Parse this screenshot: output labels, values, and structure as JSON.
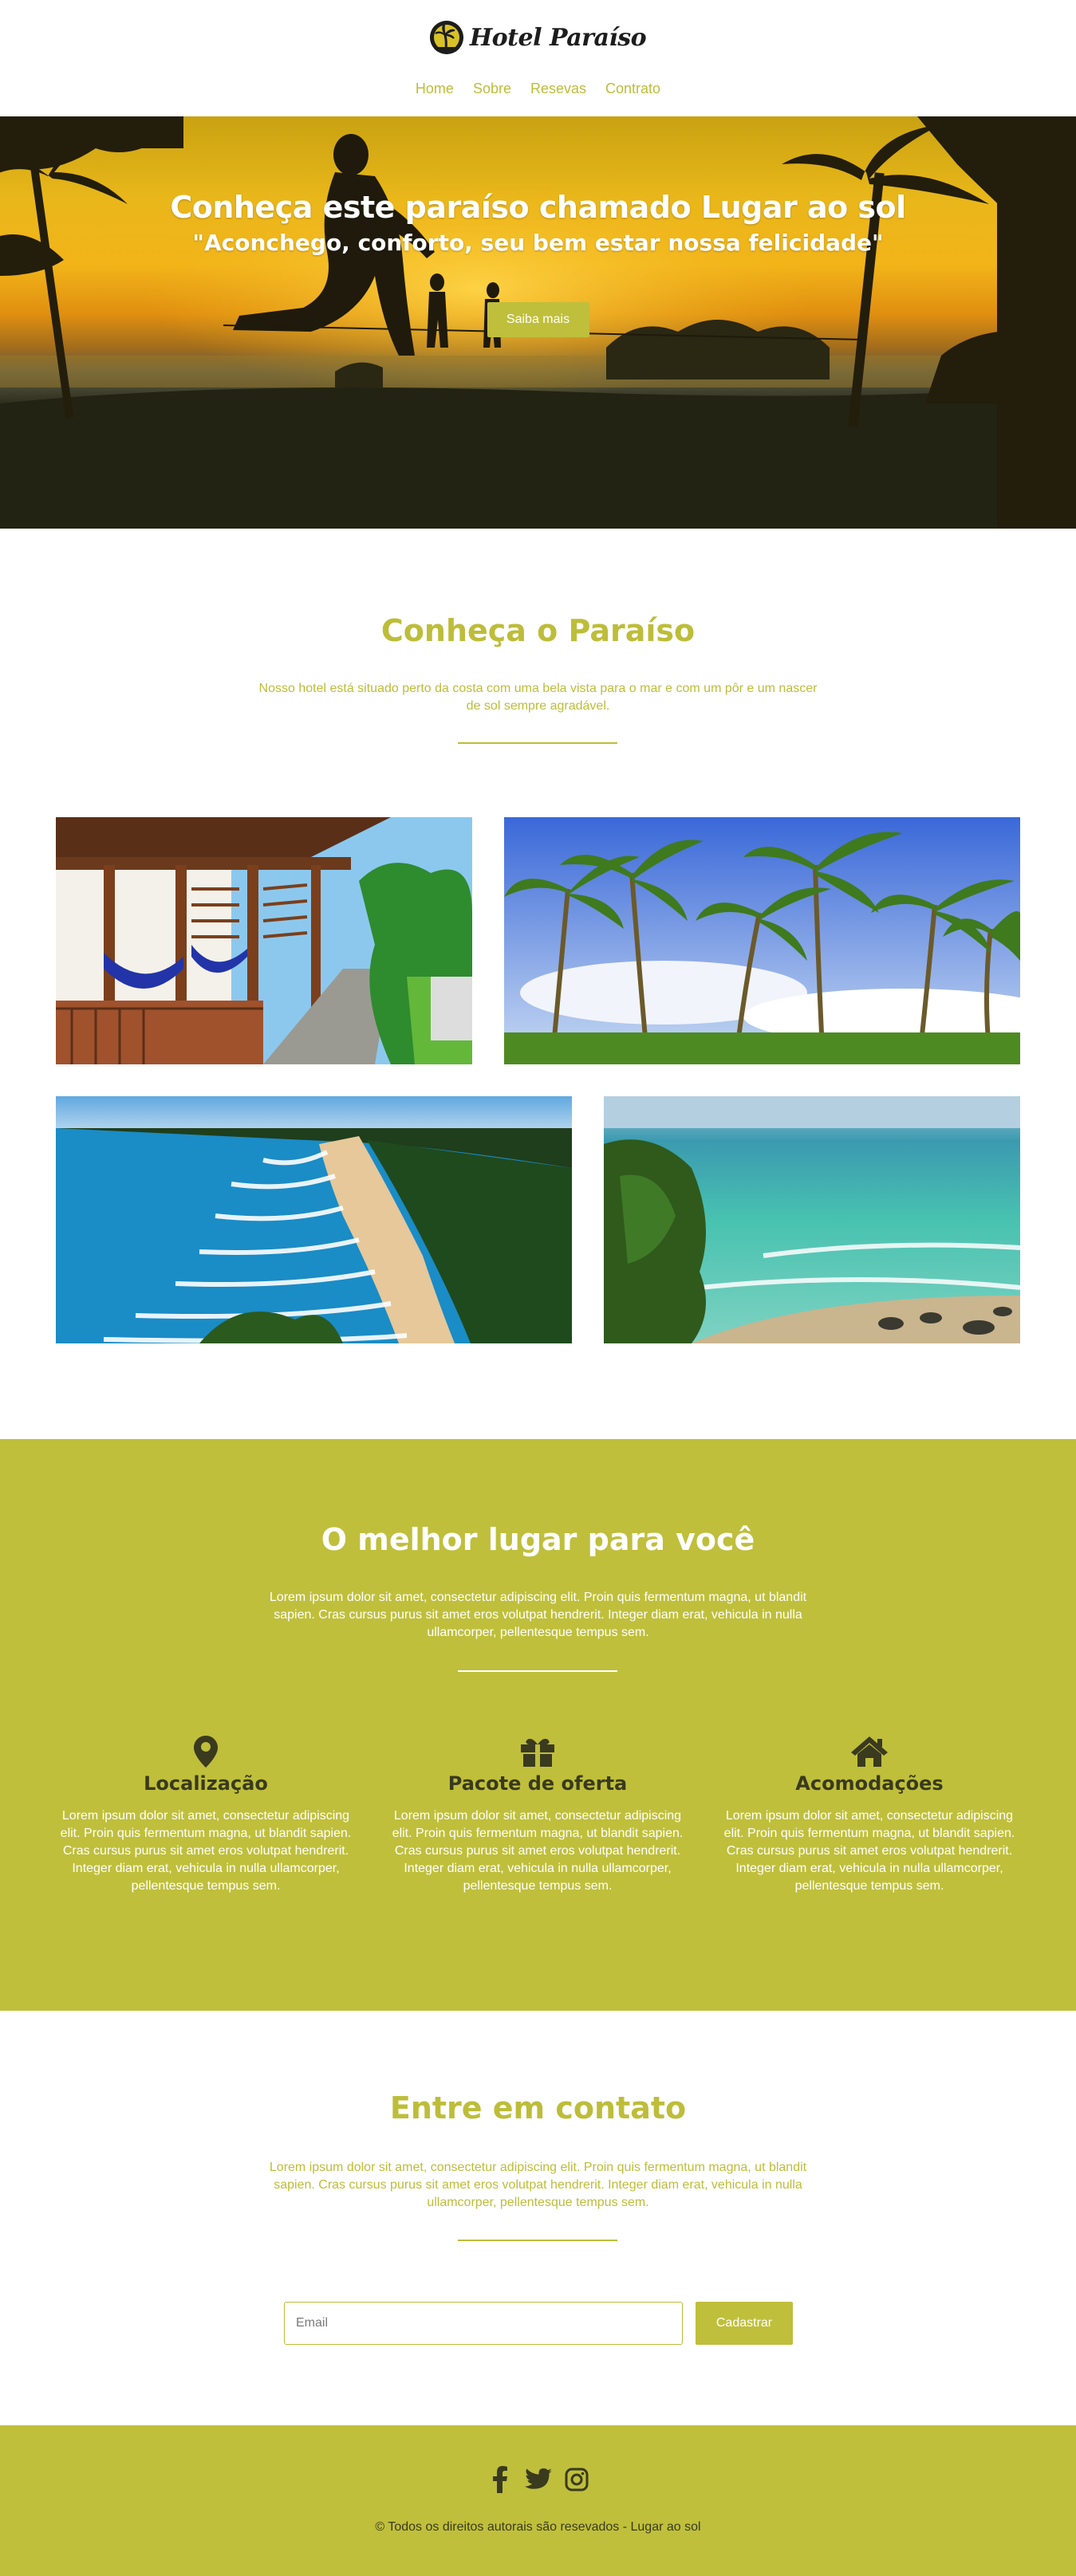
{
  "brand": {
    "name": "Hotel Paraíso"
  },
  "nav": {
    "items": [
      {
        "label": "Home"
      },
      {
        "label": "Sobre"
      },
      {
        "label": "Resevas"
      },
      {
        "label": "Contrato"
      }
    ]
  },
  "hero": {
    "title": "Conheça este paraíso chamado Lugar ao sol",
    "subtitle": "\"Aconchego, conforto, seu bem estar nossa felicidade\"",
    "button_label": "Saiba mais"
  },
  "conheca": {
    "title": "Conheça o Paraíso",
    "description": "Nosso hotel está situado perto da costa com uma bela vista para o mar e com um pôr e um nascer de sol sempre agradável.",
    "photos": [
      {
        "icon": "hotel-veranda-photo"
      },
      {
        "icon": "palm-trees-photo"
      },
      {
        "icon": "beach-coast-photo"
      },
      {
        "icon": "turquoise-sea-photo"
      }
    ]
  },
  "melhor": {
    "title": "O melhor lugar para você",
    "description": "Lorem ipsum dolor sit amet, consectetur adipiscing elit. Proin quis fermentum magna, ut blandit sapien. Cras cursus purus sit amet eros volutpat hendrerit. Integer diam erat, vehicula in nulla ullamcorper, pellentesque tempus sem.",
    "features": [
      {
        "icon": "map-marker-icon",
        "title": "Localização",
        "text": "Lorem ipsum dolor sit amet, consectetur adipiscing elit. Proin quis fermentum magna, ut blandit sapien. Cras cursus purus sit amet eros volutpat hendrerit. Integer diam erat, vehicula in nulla ullamcorper, pellentesque tempus sem."
      },
      {
        "icon": "gift-icon",
        "title": "Pacote de oferta",
        "text": "Lorem ipsum dolor sit amet, consectetur adipiscing elit. Proin quis fermentum magna, ut blandit sapien. Cras cursus purus sit amet eros volutpat hendrerit. Integer diam erat, vehicula in nulla ullamcorper, pellentesque tempus sem."
      },
      {
        "icon": "home-icon",
        "title": "Acomodações",
        "text": "Lorem ipsum dolor sit amet, consectetur adipiscing elit. Proin quis fermentum magna, ut blandit sapien. Cras cursus purus sit amet eros volutpat hendrerit. Integer diam erat, vehicula in nulla ullamcorper, pellentesque tempus sem."
      }
    ]
  },
  "contato": {
    "title": "Entre em contato",
    "description": "Lorem ipsum dolor sit amet, consectetur adipiscing elit. Proin quis fermentum magna, ut blandit sapien. Cras cursus purus sit amet eros volutpat hendrerit. Integer diam erat, vehicula in nulla ullamcorper, pellentesque tempus sem.",
    "email_placeholder": "Email",
    "submit_label": "Cadastrar"
  },
  "footer": {
    "socials": [
      {
        "icon": "facebook-icon"
      },
      {
        "icon": "twitter-icon"
      },
      {
        "icon": "instagram-icon"
      }
    ],
    "copyright": "© Todos os direitos autorais são resevados - Lugar ao sol"
  },
  "colors": {
    "accent": "#bfbf3c",
    "dark_text": "#3a3a1e",
    "hero_dark": "#1f1f10"
  }
}
